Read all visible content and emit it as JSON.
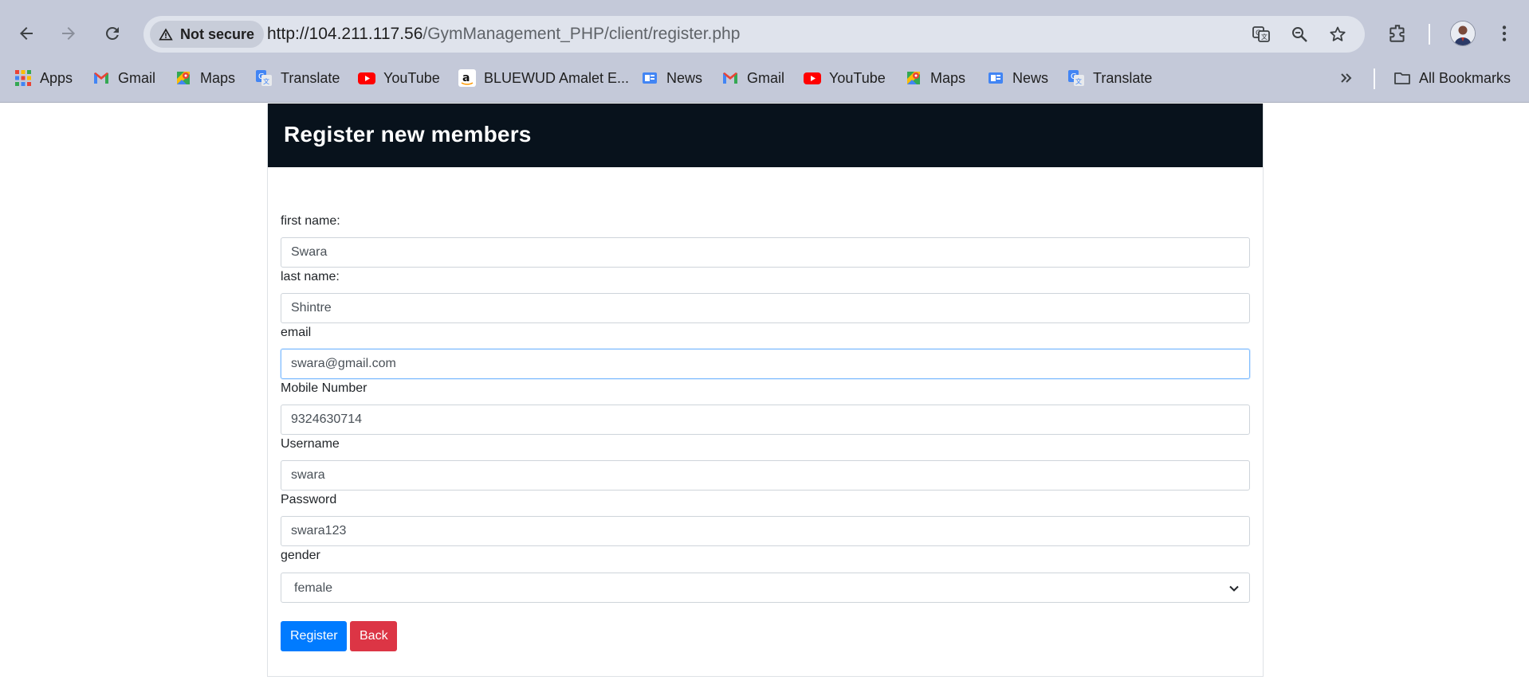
{
  "browser": {
    "security_label": "Not secure",
    "url_host": "http://104.211.117.56",
    "url_path": "/GymManagement_PHP/client/register.php",
    "all_bookmarks_label": "All Bookmarks"
  },
  "bookmarks": [
    {
      "label": "Apps",
      "icon": "apps-grid-icon"
    },
    {
      "label": "Gmail",
      "icon": "gmail-icon"
    },
    {
      "label": "Maps",
      "icon": "maps-icon"
    },
    {
      "label": "Translate",
      "icon": "translate-icon"
    },
    {
      "label": "YouTube",
      "icon": "youtube-icon"
    },
    {
      "label": "BLUEWUD Amalet E...",
      "icon": "amazon-icon"
    },
    {
      "label": "News",
      "icon": "news-icon"
    },
    {
      "label": "Gmail",
      "icon": "gmail-icon"
    },
    {
      "label": "YouTube",
      "icon": "youtube-icon"
    },
    {
      "label": "Maps",
      "icon": "maps-icon"
    },
    {
      "label": "News",
      "icon": "news-icon"
    },
    {
      "label": "Translate",
      "icon": "translate-icon"
    }
  ],
  "page": {
    "title": "Register new members",
    "fields": {
      "first_name": {
        "label": "first name:",
        "value": "Swara"
      },
      "last_name": {
        "label": "last name:",
        "value": "Shintre"
      },
      "email": {
        "label": "email",
        "value": "swara@gmail.com"
      },
      "mobile": {
        "label": "Mobile Number",
        "value": "9324630714"
      },
      "username": {
        "label": "Username",
        "value": "swara"
      },
      "password": {
        "label": "Password",
        "value": "swara123"
      },
      "gender": {
        "label": "gender",
        "value": "female"
      }
    },
    "buttons": {
      "register": "Register",
      "back": "Back"
    }
  },
  "colors": {
    "header_bg": "#08121c",
    "primary": "#007bff",
    "danger": "#dc3545",
    "chrome_bg": "#c4c9d9"
  }
}
